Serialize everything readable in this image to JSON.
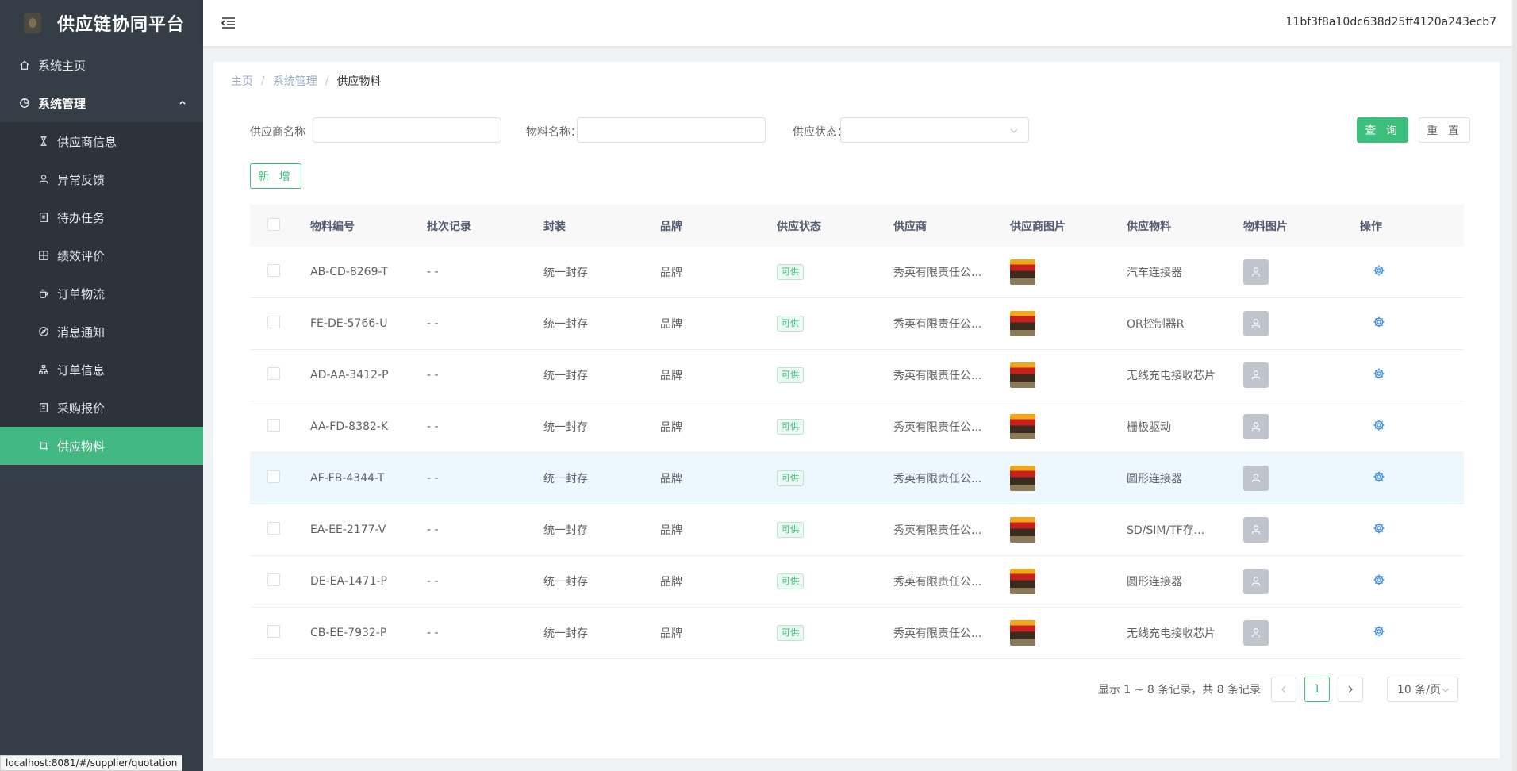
{
  "app": {
    "title": "供应链协同平台",
    "user_id": "11bf3f8a10dc638d25ff4120a243ecb7"
  },
  "sidebar": {
    "home": "系统主页",
    "group": "系统管理",
    "items": [
      {
        "label": "供应商信息",
        "icon": "hourglass-icon"
      },
      {
        "label": "异常反馈",
        "icon": "user-icon"
      },
      {
        "label": "待办任务",
        "icon": "document-icon"
      },
      {
        "label": "绩效评价",
        "icon": "grid-icon"
      },
      {
        "label": "订单物流",
        "icon": "coffee-icon"
      },
      {
        "label": "消息通知",
        "icon": "compass-icon"
      },
      {
        "label": "订单信息",
        "icon": "org-icon"
      },
      {
        "label": "采购报价",
        "icon": "document-icon"
      },
      {
        "label": "供应物料",
        "icon": "crop-icon",
        "active": true
      }
    ]
  },
  "breadcrumb": {
    "home": "主页",
    "level1": "系统管理",
    "current": "供应物料"
  },
  "search": {
    "supplier_label": "供应商名称",
    "material_label": "物料名称：",
    "status_label": "供应状态：",
    "query_btn": "查 询",
    "reset_btn": "重 置",
    "add_btn": "新 增"
  },
  "table": {
    "headers": [
      "物料编号",
      "批次记录",
      "封装",
      "品牌",
      "供应状态",
      "供应商",
      "供应商图片",
      "供应物料",
      "物料图片",
      "操作"
    ],
    "rows": [
      {
        "code": "AB-CD-8269-T",
        "batch": "- -",
        "pack": "统一封存",
        "brand": "品牌",
        "status": "可供",
        "supplier": "秀英有限责任公...",
        "material": "汽车连接器"
      },
      {
        "code": "FE-DE-5766-U",
        "batch": "- -",
        "pack": "统一封存",
        "brand": "品牌",
        "status": "可供",
        "supplier": "秀英有限责任公...",
        "material": "OR控制器R"
      },
      {
        "code": "AD-AA-3412-P",
        "batch": "- -",
        "pack": "统一封存",
        "brand": "品牌",
        "status": "可供",
        "supplier": "秀英有限责任公...",
        "material": "无线充电接收芯片"
      },
      {
        "code": "AA-FD-8382-K",
        "batch": "- -",
        "pack": "统一封存",
        "brand": "品牌",
        "status": "可供",
        "supplier": "秀英有限责任公...",
        "material": "栅极驱动"
      },
      {
        "code": "AF-FB-4344-T",
        "batch": "- -",
        "pack": "统一封存",
        "brand": "品牌",
        "status": "可供",
        "supplier": "秀英有限责任公...",
        "material": "圆形连接器"
      },
      {
        "code": "EA-EE-2177-V",
        "batch": "- -",
        "pack": "统一封存",
        "brand": "品牌",
        "status": "可供",
        "supplier": "秀英有限责任公...",
        "material": "SD/SIM/TF存..."
      },
      {
        "code": "DE-EA-1471-P",
        "batch": "- -",
        "pack": "统一封存",
        "brand": "品牌",
        "status": "可供",
        "supplier": "秀英有限责任公...",
        "material": "圆形连接器"
      },
      {
        "code": "CB-EE-7932-P",
        "batch": "- -",
        "pack": "统一封存",
        "brand": "品牌",
        "status": "可供",
        "supplier": "秀英有限责任公...",
        "material": "无线充电接收芯片"
      }
    ]
  },
  "pagination": {
    "total_text": "显示 1 ~ 8 条记录，共 8 条记录",
    "current_page": "1",
    "page_size": "10 条/页"
  },
  "status_url": "localhost:8081/#/supplier/quotation",
  "colors": {
    "sidebar_bg": "#353d46",
    "accent": "#42b983",
    "primary_btn": "#3cbf7d"
  }
}
